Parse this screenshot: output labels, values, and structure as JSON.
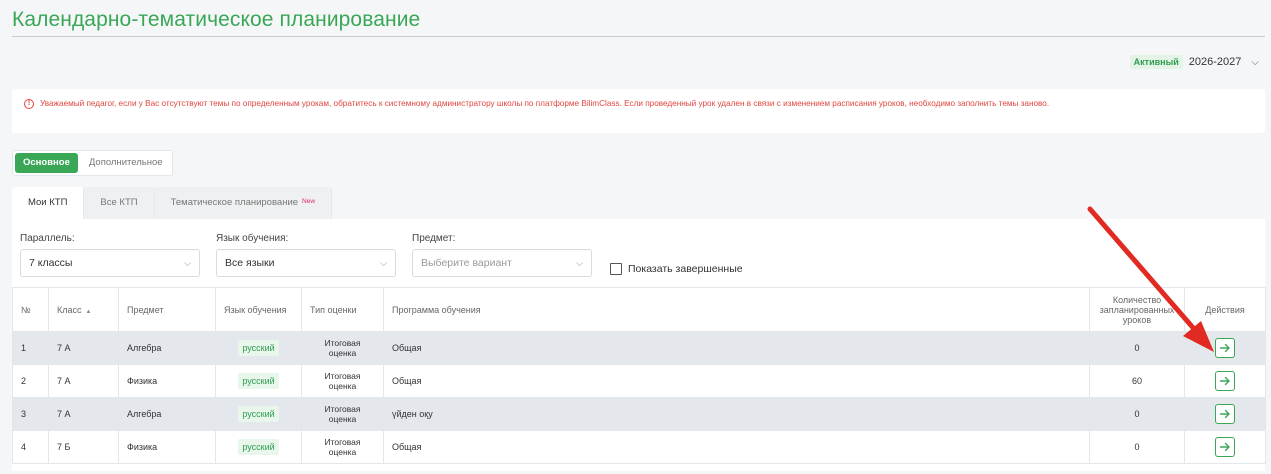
{
  "page": {
    "title": "Календарно-тематическое планирование"
  },
  "year_selector": {
    "badge": "Активный",
    "value": "2026-2027"
  },
  "warning": {
    "icon": "info-circle-icon",
    "text": "Уважаемый педагог, если у Вас отсутствуют темы по определенным урокам, обратитесь к системному администратору школы по платформе BilimClass. Если проведенный урок удален в связи с изменением расписания уроков, необходимо заполнить темы заново."
  },
  "segment": {
    "items": [
      {
        "label": "Основное",
        "active": true
      },
      {
        "label": "Дополнительное",
        "active": false
      }
    ]
  },
  "tabs": [
    {
      "label": "Мои КТП",
      "active": true
    },
    {
      "label": "Все КТП",
      "active": false
    },
    {
      "label": "Тематическое планирование",
      "badge": "New",
      "active": false
    }
  ],
  "filters": {
    "parallel": {
      "label": "Параллель:",
      "value": "7 классы"
    },
    "language": {
      "label": "Язык обучения:",
      "value": "Все языки"
    },
    "subject": {
      "label": "Предмет:",
      "placeholder": "Выберите вариант"
    },
    "show_completed": {
      "label": "Показать завершенные",
      "checked": false
    }
  },
  "table": {
    "headers": {
      "num": "№",
      "class": "Класс",
      "subject": "Предмет",
      "language": "Язык обучения",
      "grade_type": "Тип оценки",
      "program": "Программа обучения",
      "count": "Количество запланированных уроков",
      "actions": "Действия"
    },
    "rows": [
      {
        "num": "1",
        "class": "7 А",
        "subject": "Алгебра",
        "language": "русский",
        "grade_type": "Итоговая оценка",
        "program": "Общая",
        "count": "0"
      },
      {
        "num": "2",
        "class": "7 А",
        "subject": "Физика",
        "language": "русский",
        "grade_type": "Итоговая оценка",
        "program": "Общая",
        "count": "60"
      },
      {
        "num": "3",
        "class": "7 А",
        "subject": "Алгебра",
        "language": "русский",
        "grade_type": "Итоговая оценка",
        "program": "үйден оқу",
        "count": "0"
      },
      {
        "num": "4",
        "class": "7 Б",
        "subject": "Физика",
        "language": "русский",
        "grade_type": "Итоговая оценка",
        "program": "Общая",
        "count": "0"
      }
    ]
  },
  "colors": {
    "accent": "#3aa757",
    "warning": "#e0463e",
    "annotation_arrow": "#e02a22"
  }
}
